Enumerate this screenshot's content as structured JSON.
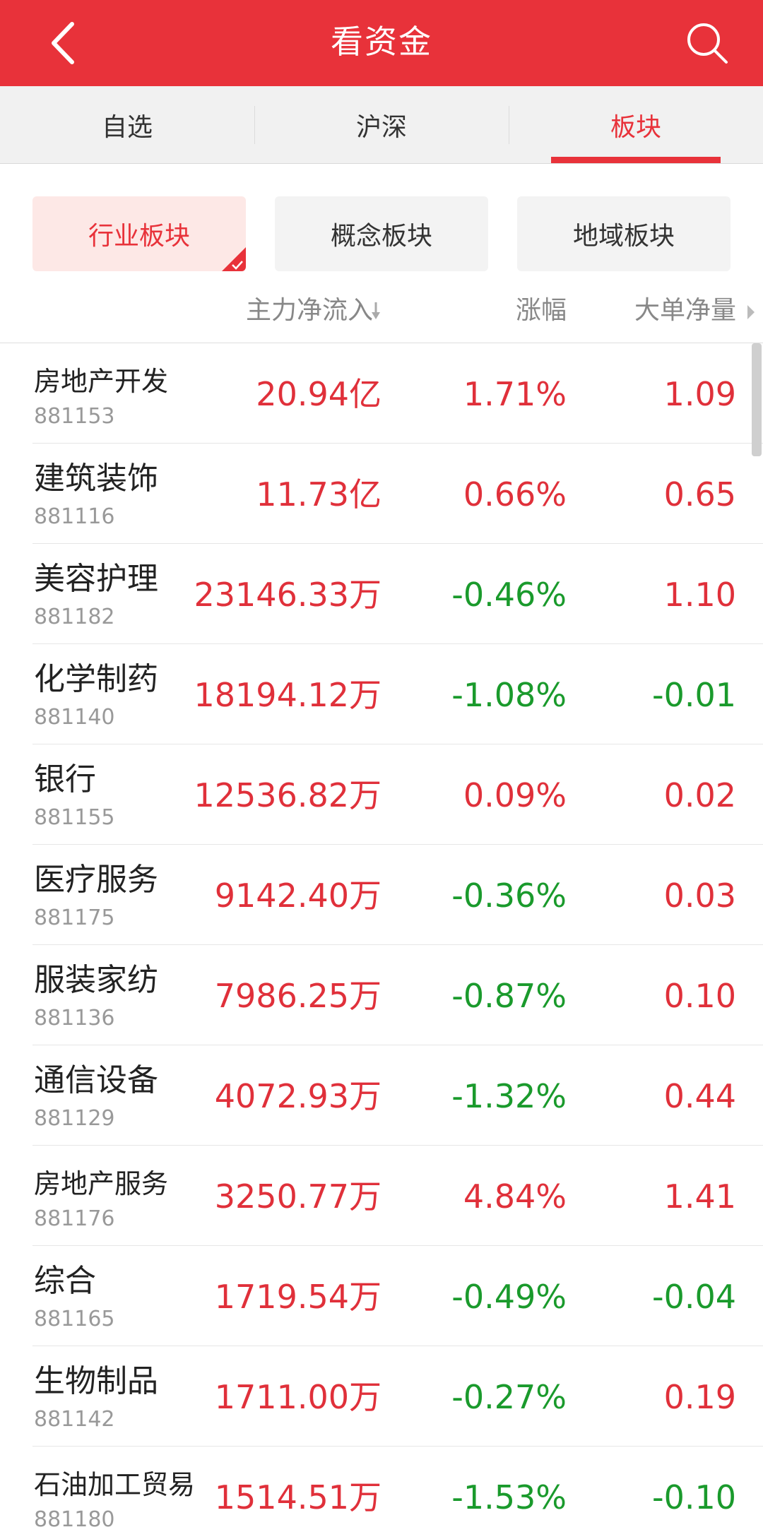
{
  "header": {
    "title": "看资金",
    "back_icon": "chevron-left-icon",
    "search_icon": "search-icon"
  },
  "tabs": [
    {
      "label": "自选",
      "active": false
    },
    {
      "label": "沪深",
      "active": false
    },
    {
      "label": "板块",
      "active": true
    }
  ],
  "segments": [
    {
      "label": "行业板块",
      "active": true
    },
    {
      "label": "概念板块",
      "active": false
    },
    {
      "label": "地域板块",
      "active": false
    }
  ],
  "columns": {
    "net_inflow": "主力净流入",
    "change": "涨幅",
    "big_order": "大单净量"
  },
  "colors": {
    "accent": "#e8323a",
    "up": "#e0303a",
    "down": "#1a9a2c"
  },
  "rows": [
    {
      "name": "房地产开发",
      "code": "881153",
      "net_inflow": "20.94亿",
      "change": "1.71%",
      "big_order": "1.09"
    },
    {
      "name": "建筑装饰",
      "code": "881116",
      "net_inflow": "11.73亿",
      "change": "0.66%",
      "big_order": "0.65"
    },
    {
      "name": "美容护理",
      "code": "881182",
      "net_inflow": "23146.33万",
      "change": "-0.46%",
      "big_order": "1.10"
    },
    {
      "name": "化学制药",
      "code": "881140",
      "net_inflow": "18194.12万",
      "change": "-1.08%",
      "big_order": "-0.01"
    },
    {
      "name": "银行",
      "code": "881155",
      "net_inflow": "12536.82万",
      "change": "0.09%",
      "big_order": "0.02"
    },
    {
      "name": "医疗服务",
      "code": "881175",
      "net_inflow": "9142.40万",
      "change": "-0.36%",
      "big_order": "0.03"
    },
    {
      "name": "服装家纺",
      "code": "881136",
      "net_inflow": "7986.25万",
      "change": "-0.87%",
      "big_order": "0.10"
    },
    {
      "name": "通信设备",
      "code": "881129",
      "net_inflow": "4072.93万",
      "change": "-1.32%",
      "big_order": "0.44"
    },
    {
      "name": "房地产服务",
      "code": "881176",
      "net_inflow": "3250.77万",
      "change": "4.84%",
      "big_order": "1.41"
    },
    {
      "name": "综合",
      "code": "881165",
      "net_inflow": "1719.54万",
      "change": "-0.49%",
      "big_order": "-0.04"
    },
    {
      "name": "生物制品",
      "code": "881142",
      "net_inflow": "1711.00万",
      "change": "-0.27%",
      "big_order": "0.19"
    },
    {
      "name": "石油加工贸易",
      "code": "881180",
      "net_inflow": "1514.51万",
      "change": "-1.53%",
      "big_order": "-0.10"
    }
  ]
}
